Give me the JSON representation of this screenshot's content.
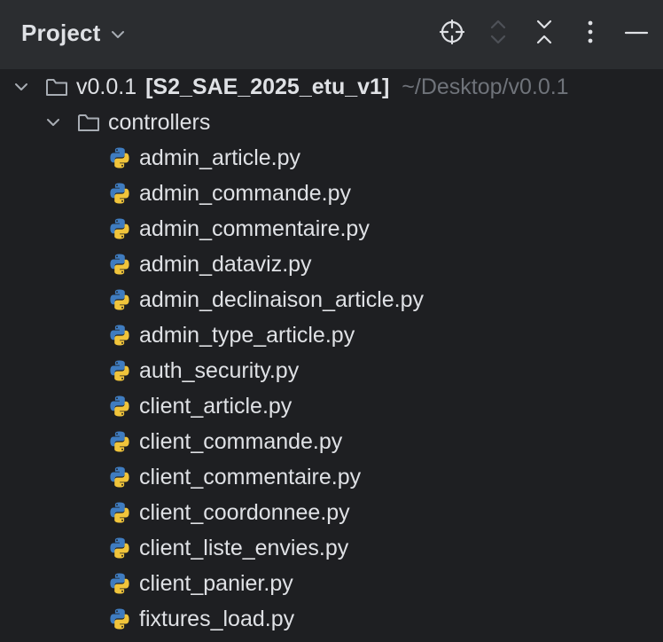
{
  "header": {
    "title": "Project",
    "title_dropdown_icon": "chevron-down-icon",
    "actions": [
      {
        "name": "locate-icon",
        "enabled": true
      },
      {
        "name": "expand-collapse-icon",
        "enabled": false
      },
      {
        "name": "collapse-all-icon",
        "enabled": true
      },
      {
        "name": "more-options-icon",
        "enabled": true
      },
      {
        "name": "minimize-icon",
        "enabled": true
      }
    ]
  },
  "tree": {
    "root": {
      "name": "v0.0.1",
      "project_label": "[S2_SAE_2025_etu_v1]",
      "path": "~/Desktop/v0.0.1",
      "expanded": true,
      "icon": "folder-icon"
    },
    "folder": {
      "name": "controllers",
      "expanded": true,
      "icon": "folder-icon"
    },
    "files": [
      "admin_article.py",
      "admin_commande.py",
      "admin_commentaire.py",
      "admin_dataviz.py",
      "admin_declinaison_article.py",
      "admin_type_article.py",
      "auth_security.py",
      "client_article.py",
      "client_commande.py",
      "client_commentaire.py",
      "client_coordonnee.py",
      "client_liste_envies.py",
      "client_panier.py",
      "fixtures_load.py"
    ],
    "file_icon": "python-file-icon"
  },
  "colors": {
    "header_bg": "#2b2d30",
    "tree_bg": "#1e1f22",
    "text": "#dfe1e5",
    "muted_text": "#6f737a",
    "python_blue": "#3f7cc0",
    "python_yellow": "#f0c43b"
  }
}
